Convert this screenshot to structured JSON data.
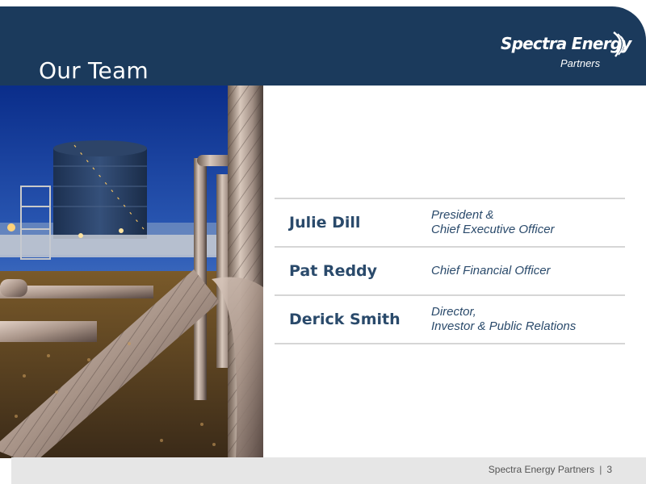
{
  "header": {
    "title": "Our Team",
    "logo": {
      "main": "Spectra Energy",
      "sub": "Partners",
      "icon": "swoosh-logo-icon"
    }
  },
  "photo": {
    "icon": "industrial-pipeline-photo"
  },
  "team": [
    {
      "name": "Julie Dill",
      "role": "President &\nChief Executive Officer"
    },
    {
      "name": "Pat Reddy",
      "role": "Chief Financial Officer"
    },
    {
      "name": "Derick Smith",
      "role": "Director,\nInvestor & Public Relations"
    }
  ],
  "footer": {
    "company": "Spectra Energy Partners",
    "separator": "|",
    "page": "3"
  },
  "colors": {
    "header_bg": "#1b3a5c",
    "accent_text": "#2a4a6b",
    "footer_bg": "#e6e6e6",
    "divider": "#d6d6d6"
  }
}
